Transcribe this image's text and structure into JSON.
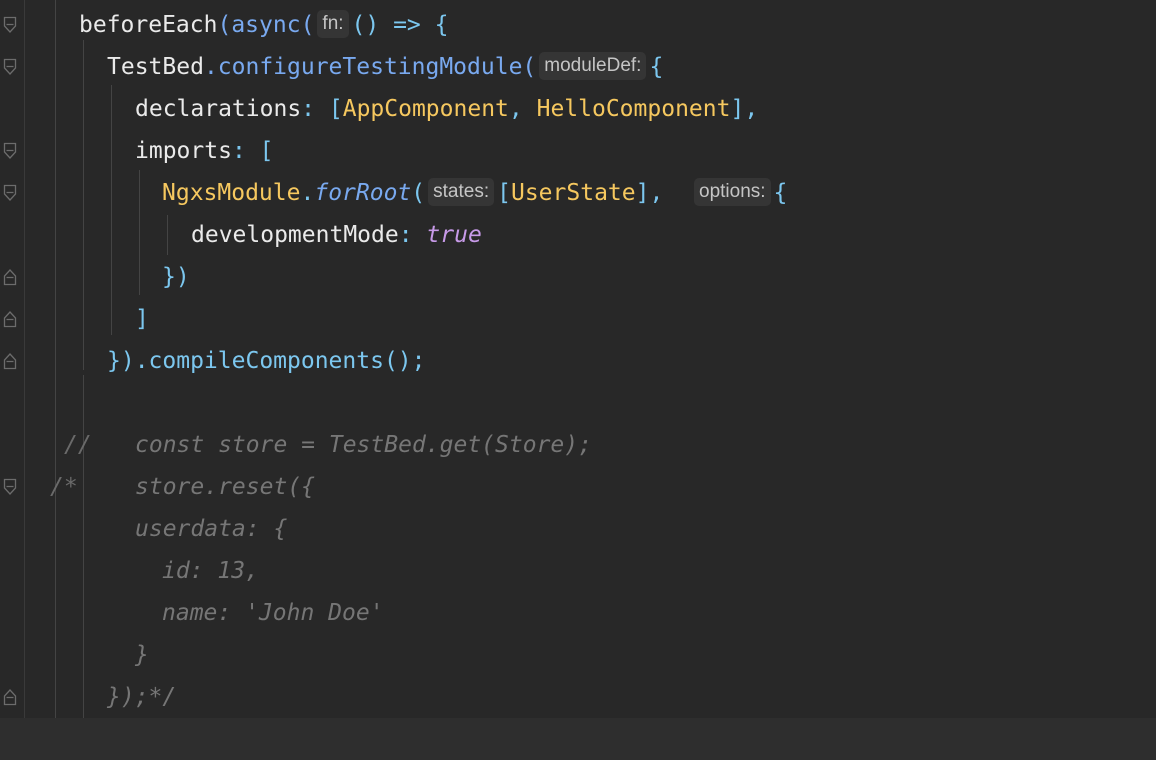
{
  "editor": {
    "lines": [
      {
        "tokens": [
          {
            "t": "beforeEach",
            "c": "plain"
          },
          {
            "t": "(async(",
            "c": "fn"
          },
          {
            "hint": "fn:"
          },
          {
            "t": "() => {",
            "c": "punc"
          }
        ]
      },
      {
        "tokens": [
          {
            "t": "TestBed",
            "c": "plain"
          },
          {
            "t": ".configureTestingModule(",
            "c": "fn"
          },
          {
            "hint": "moduleDef:"
          },
          {
            "t": "{",
            "c": "punc"
          }
        ]
      },
      {
        "tokens": [
          {
            "t": "declarations",
            "c": "plain"
          },
          {
            "t": ": [",
            "c": "punc"
          },
          {
            "t": "AppComponent",
            "c": "class"
          },
          {
            "t": ", ",
            "c": "punc"
          },
          {
            "t": "HelloComponent",
            "c": "class"
          },
          {
            "t": "],",
            "c": "punc"
          }
        ]
      },
      {
        "tokens": [
          {
            "t": "imports",
            "c": "plain"
          },
          {
            "t": ": [",
            "c": "punc"
          }
        ]
      },
      {
        "tokens": [
          {
            "t": "NgxsModule",
            "c": "class"
          },
          {
            "t": ".",
            "c": "punc"
          },
          {
            "t": "forRoot",
            "c": "italic"
          },
          {
            "t": "(",
            "c": "punc"
          },
          {
            "hint": "states:"
          },
          {
            "t": "[",
            "c": "punc"
          },
          {
            "t": "UserState",
            "c": "class"
          },
          {
            "t": "],  ",
            "c": "punc"
          },
          {
            "hint": "options:"
          },
          {
            "t": "{",
            "c": "punc"
          }
        ]
      },
      {
        "tokens": [
          {
            "t": "developmentMode",
            "c": "plain"
          },
          {
            "t": ": ",
            "c": "punc"
          },
          {
            "t": "true",
            "c": "bool"
          }
        ]
      },
      {
        "tokens": [
          {
            "t": "})",
            "c": "punc"
          }
        ]
      },
      {
        "tokens": [
          {
            "t": "]",
            "c": "punc"
          }
        ]
      },
      {
        "tokens": [
          {
            "t": "}).compileComponents();",
            "c": "punc"
          }
        ]
      },
      {
        "tokens": []
      },
      {
        "tokens": [
          {
            "t": "const store = TestBed.get(Store);",
            "c": "comment"
          }
        ]
      },
      {
        "tokens": [
          {
            "t": "store.reset({",
            "c": "comment"
          }
        ]
      },
      {
        "tokens": [
          {
            "t": "userdata: {",
            "c": "comment"
          }
        ]
      },
      {
        "tokens": [
          {
            "t": "id: 13,",
            "c": "comment"
          }
        ]
      },
      {
        "tokens": [
          {
            "t": "name: 'John Doe'",
            "c": "comment"
          }
        ]
      },
      {
        "tokens": [
          {
            "t": "}",
            "c": "comment"
          }
        ]
      },
      {
        "tokens": [
          {
            "t": "});*/",
            "c": "comment"
          }
        ]
      },
      {
        "tokens": []
      }
    ],
    "comment_markers": [
      {
        "line": 10,
        "text": "//"
      },
      {
        "line": 11,
        "text": "/*"
      }
    ],
    "fold_markers": [
      {
        "line": 0,
        "type": "open"
      },
      {
        "line": 1,
        "type": "open"
      },
      {
        "line": 3,
        "type": "open"
      },
      {
        "line": 4,
        "type": "open"
      },
      {
        "line": 6,
        "type": "close"
      },
      {
        "line": 7,
        "type": "close"
      },
      {
        "line": 8,
        "type": "close"
      },
      {
        "line": 11,
        "type": "open"
      },
      {
        "line": 16,
        "type": "close"
      }
    ],
    "current_line": 17
  }
}
